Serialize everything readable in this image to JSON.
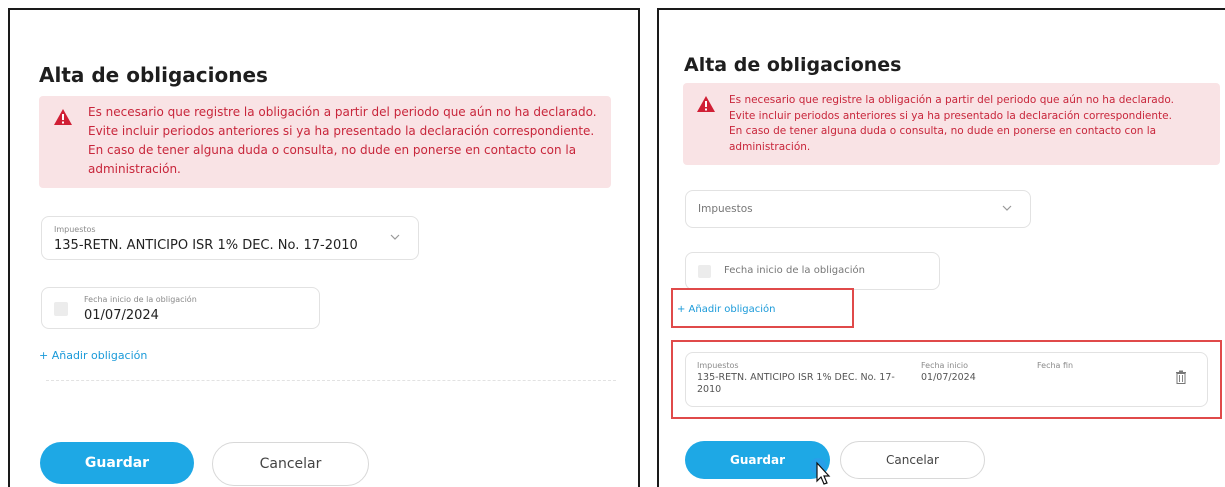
{
  "left": {
    "title": "Alta de obligaciones",
    "alert_lines": [
      "Es necesario que registre la obligación a partir del periodo que aún no ha declarado.",
      "Evite incluir periodos anteriores si ya ha presentado la declaración correspondiente.",
      "En caso de tener alguna duda o consulta, no dude en ponerse en contacto con la",
      "administración."
    ],
    "tax_select": {
      "label": "Impuestos",
      "value": "135-RETN. ANTICIPO ISR 1% DEC. No. 17-2010"
    },
    "date_field": {
      "label": "Fecha inicio de la obligación",
      "value": "01/07/2024"
    },
    "add_link": "+ Añadir obligación",
    "save_label": "Guardar",
    "cancel_label": "Cancelar"
  },
  "right": {
    "title": "Alta de obligaciones",
    "alert_lines": [
      "Es necesario que registre la obligación a partir del periodo que aún no ha declarado.",
      "Evite incluir periodos anteriores si ya ha presentado la declaración correspondiente.",
      "En caso de tener alguna duda o consulta, no dude en ponerse en contacto con la",
      "administración."
    ],
    "tax_select": {
      "placeholder": "Impuestos"
    },
    "date_field": {
      "placeholder": "Fecha inicio de la obligación"
    },
    "add_link": "+ Añadir obligación",
    "obligation_row": {
      "tax_label": "Impuestos",
      "tax_value_line1": "135-RETN. ANTICIPO ISR 1% DEC. No. 17-",
      "tax_value_line2": "2010",
      "start_label": "Fecha inicio",
      "start_value": "01/07/2024",
      "end_label": "Fecha fin",
      "end_value": ""
    },
    "save_label": "Guardar",
    "cancel_label": "Cancelar"
  },
  "colors": {
    "accent": "#1ea8e5",
    "alert_bg": "#f9e3e5",
    "alert_text": "#c8263b",
    "highlight": "#e04a4a",
    "link": "#1a9ad9"
  }
}
